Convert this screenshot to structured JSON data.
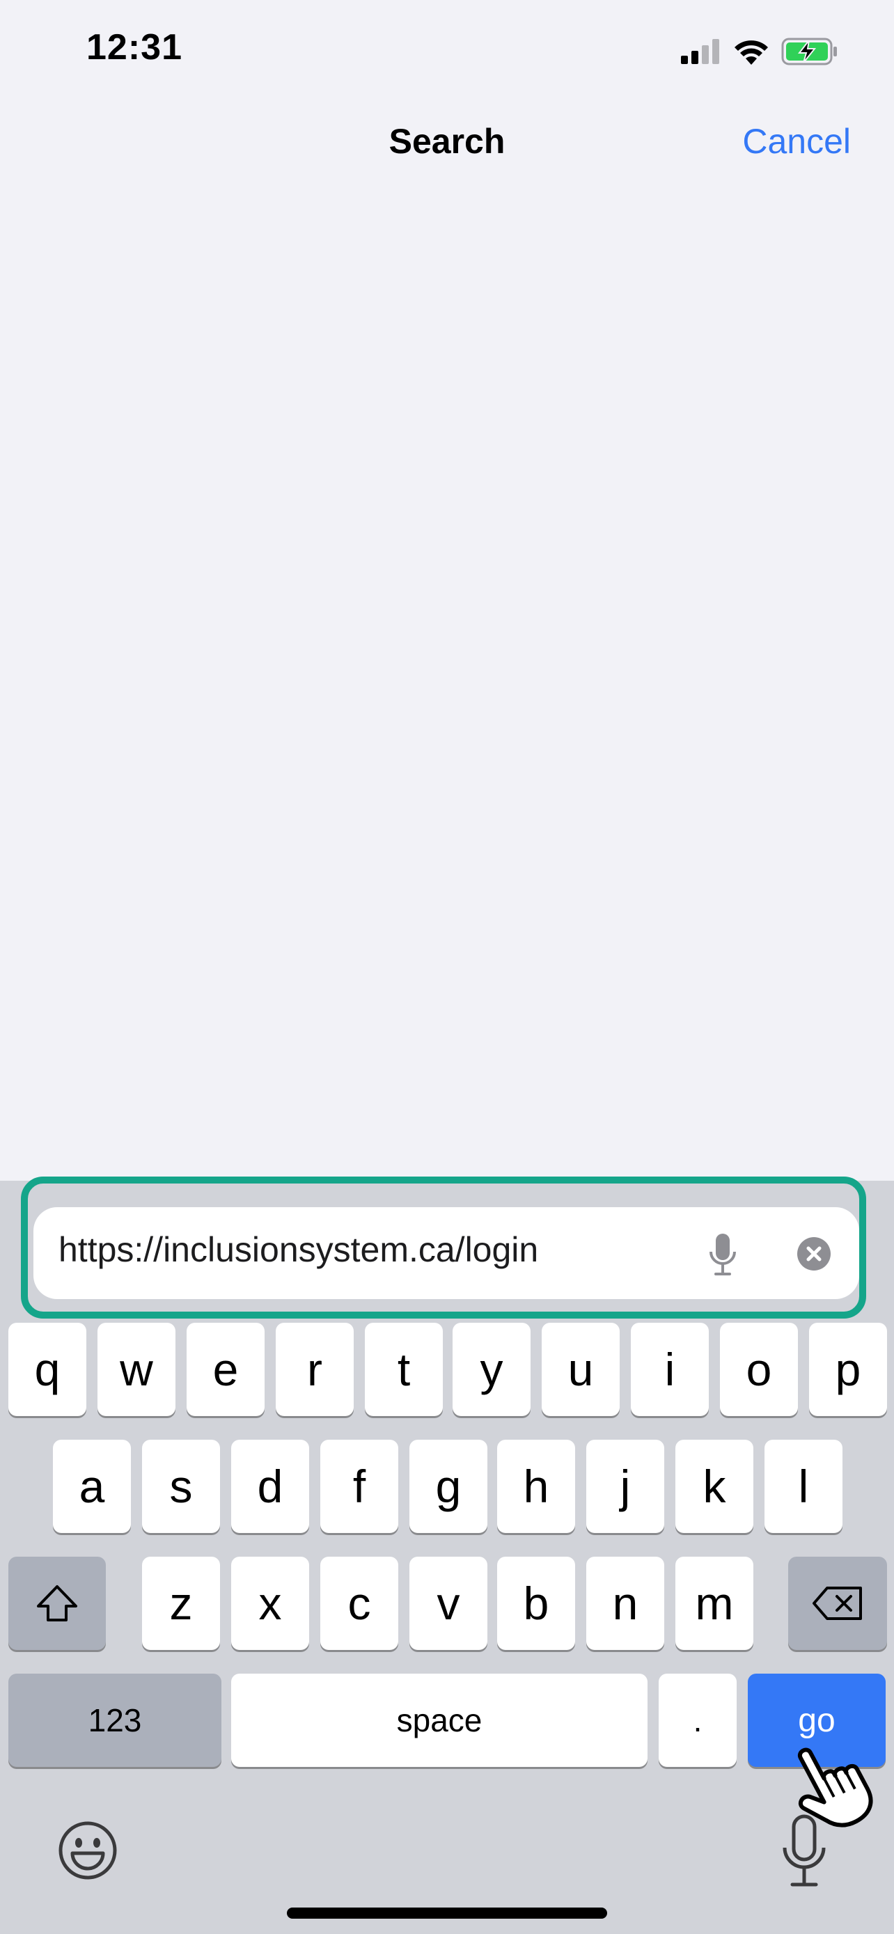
{
  "status_bar": {
    "time": "12:31",
    "icons": [
      "cellular-signal-icon",
      "wifi-icon",
      "battery-charging-icon"
    ],
    "battery_color": "#30d158"
  },
  "nav": {
    "title": "Search",
    "cancel_label": "Cancel",
    "accent_color": "#3478f6"
  },
  "search_field": {
    "value": "https://inclusionsystem.ca/login",
    "icons": [
      "microphone-icon",
      "clear-icon"
    ],
    "highlight_color": "#15a58a"
  },
  "keyboard": {
    "row1": [
      "q",
      "w",
      "e",
      "r",
      "t",
      "y",
      "u",
      "i",
      "o",
      "p"
    ],
    "row2": [
      "a",
      "s",
      "d",
      "f",
      "g",
      "h",
      "j",
      "k",
      "l"
    ],
    "row3": [
      "z",
      "x",
      "c",
      "v",
      "b",
      "n",
      "m"
    ],
    "numbers_label": "123",
    "space_label": "space",
    "period_label": ".",
    "go_label": "go",
    "icons": [
      "shift-icon",
      "backspace-icon",
      "emoji-icon",
      "dictation-icon"
    ]
  },
  "overlay": {
    "icons": [
      "pointer-hand-icon"
    ]
  }
}
